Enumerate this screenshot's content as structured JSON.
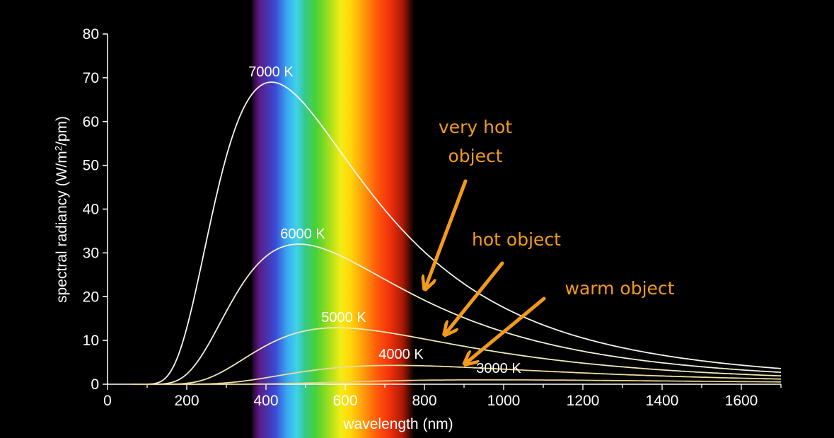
{
  "chart_data": {
    "type": "line",
    "xlabel": "wavelength (nm)",
    "ylabel_parts": {
      "main": "spectral radiancy (W/m",
      "sup": "2",
      "tail": "/pm)"
    },
    "xlim": [
      0,
      1700
    ],
    "ylim": [
      0,
      80
    ],
    "xticks": [
      0,
      200,
      400,
      600,
      800,
      1000,
      1200,
      1400,
      1600
    ],
    "yticks": [
      0,
      10,
      20,
      30,
      40,
      50,
      60,
      70,
      80
    ],
    "x_tick_labels": [
      "0",
      "200",
      "400",
      "600",
      "800",
      "1000",
      "1200",
      "1400",
      "1600"
    ],
    "y_tick_labels": [
      "0",
      "10",
      "20",
      "30",
      "40",
      "50",
      "60",
      "70",
      "80"
    ],
    "grid": false,
    "background_spectrum": {
      "from_nm": 380,
      "to_nm": 760
    },
    "series": [
      {
        "name": "7000 K",
        "temperature": 7000,
        "peak_nm": 414,
        "peak_value": 69,
        "color": "#f4f4ec",
        "x": [
          100,
          200,
          300,
          350,
          414,
          500,
          600,
          700,
          800,
          1000,
          1200,
          1400,
          1700
        ],
        "y": [
          0,
          6.9,
          46.5,
          62.8,
          69,
          63.3,
          50.2,
          37.5,
          27.4,
          14.9,
          8.6,
          5.3,
          2.8
        ]
      },
      {
        "name": "6000 K",
        "temperature": 6000,
        "peak_nm": 483,
        "peak_value": 32,
        "color": "#f1efd8",
        "x": [
          150,
          200,
          300,
          400,
          483,
          600,
          700,
          800,
          1000,
          1200,
          1400,
          1700
        ],
        "y": [
          0,
          1.0,
          12.2,
          27.3,
          32,
          28.1,
          22.6,
          17.6,
          10.3,
          6.3,
          4.0,
          2.2
        ]
      },
      {
        "name": "5000 K",
        "temperature": 5000,
        "peak_nm": 580,
        "peak_value": 12.9,
        "color": "#eee7b8",
        "x": [
          200,
          300,
          400,
          500,
          580,
          700,
          800,
          1000,
          1200,
          1400,
          1700
        ],
        "y": [
          0,
          2.0,
          7.9,
          11.9,
          12.9,
          11.8,
          10.1,
          6.7,
          4.4,
          2.9,
          1.7
        ]
      },
      {
        "name": "4000 K",
        "temperature": 4000,
        "peak_nm": 724,
        "peak_value": 4.3,
        "color": "#eadc9c",
        "x": [
          250,
          300,
          400,
          500,
          600,
          724,
          800,
          1000,
          1200,
          1400,
          1700
        ],
        "y": [
          0,
          0.2,
          1.4,
          2.9,
          3.9,
          4.3,
          4.2,
          3.4,
          2.6,
          1.9,
          1.2
        ]
      },
      {
        "name": "3000 K",
        "temperature": 3000,
        "peak_nm": 966,
        "peak_value": 1.0,
        "color": "#e6d089",
        "x": [
          350,
          500,
          700,
          966,
          1200,
          1400,
          1700
        ],
        "y": [
          0,
          0.2,
          0.7,
          1.0,
          0.95,
          0.85,
          0.6
        ]
      }
    ],
    "annotations": [
      {
        "lines": [
          "very hot",
          "object"
        ],
        "color": "#f39a1c"
      },
      {
        "lines": [
          "hot object"
        ],
        "color": "#f39a1c"
      },
      {
        "lines": [
          "warm object"
        ],
        "color": "#f39a1c"
      }
    ]
  }
}
